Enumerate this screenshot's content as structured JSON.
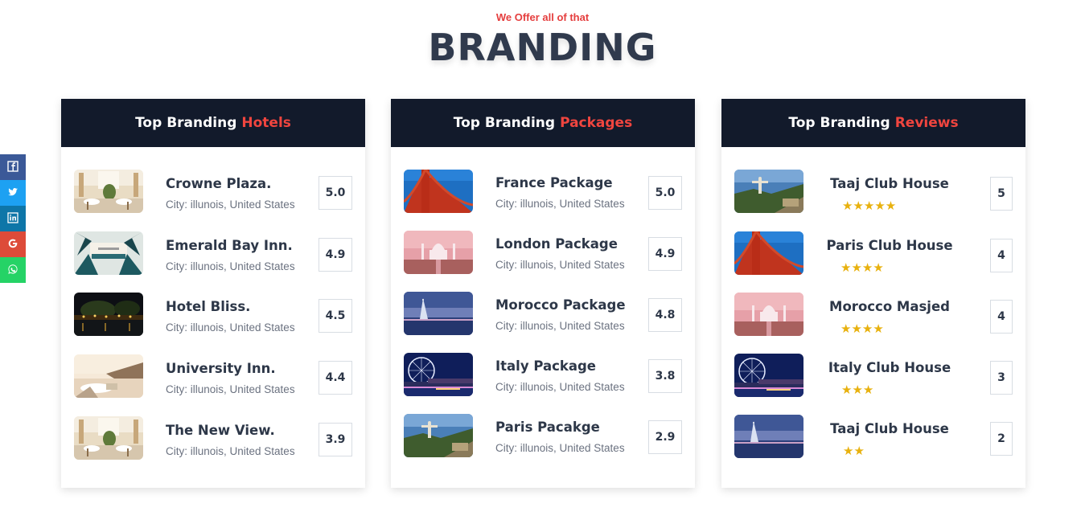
{
  "header": {
    "eyebrow": "We Offer all of that",
    "title": "BRANDING"
  },
  "social": [
    {
      "icon": "facebook-icon",
      "color": "#3b5998",
      "glyph": "f"
    },
    {
      "icon": "twitter-icon",
      "color": "#1da1f2",
      "glyph": "t"
    },
    {
      "icon": "linkedin-icon",
      "color": "#0e76a8",
      "glyph": "in"
    },
    {
      "icon": "google-icon",
      "color": "#dd4b39",
      "glyph": "G"
    },
    {
      "icon": "whatsapp-icon",
      "color": "#25d366",
      "glyph": "w"
    }
  ],
  "hotels": {
    "title": "Top Branding",
    "accent": "Hotels",
    "items": [
      {
        "name": "Crowne Plaza.",
        "city": "City: illunois, United States",
        "rating": "5.0",
        "image": "restaurant-interior"
      },
      {
        "name": "Emerald Bay Inn.",
        "city": "City: illunois, United States",
        "rating": "4.9",
        "image": "palm-resort"
      },
      {
        "name": "Hotel Bliss.",
        "city": "City: illunois, United States",
        "rating": "4.5",
        "image": "night-lake"
      },
      {
        "name": "University Inn.",
        "city": "City: illunois, United States",
        "rating": "4.4",
        "image": "coastal-terrace"
      },
      {
        "name": "The New View.",
        "city": "City: illunois, United States",
        "rating": "3.9",
        "image": "restaurant-interior"
      }
    ]
  },
  "packages": {
    "title": "Top Branding",
    "accent": "Packages",
    "items": [
      {
        "name": "France Package",
        "city": "City: illunois, United States",
        "rating": "5.0",
        "image": "golden-gate-bridge"
      },
      {
        "name": "London Package",
        "city": "City: illunois, United States",
        "rating": "4.9",
        "image": "taj-mahal"
      },
      {
        "name": "Morocco Package",
        "city": "City: illunois, United States",
        "rating": "4.8",
        "image": "burj-al-arab"
      },
      {
        "name": "Italy Package",
        "city": "City: illunois, United States",
        "rating": "3.8",
        "image": "ferris-wheel"
      },
      {
        "name": "Paris Pacakge",
        "city": "City: illunois, United States",
        "rating": "2.9",
        "image": "christ-redeemer"
      }
    ]
  },
  "reviews": {
    "title": "Top Branding",
    "accent": "Reviews",
    "items": [
      {
        "name": "Taaj Club House",
        "stars": 5,
        "stars_text": "★★★★★",
        "rating": "5",
        "image": "christ-redeemer"
      },
      {
        "name": "Paris Club House",
        "stars": 4,
        "stars_text": "★★★★",
        "rating": "4",
        "image": "golden-gate-bridge"
      },
      {
        "name": "Morocco Masjed",
        "stars": 4,
        "stars_text": "★★★★",
        "rating": "4",
        "image": "taj-mahal"
      },
      {
        "name": "Italy Club House",
        "stars": 3,
        "stars_text": "★★★",
        "rating": "3",
        "image": "ferris-wheel"
      },
      {
        "name": "Taaj Club House",
        "stars": 2,
        "stars_text": "★★",
        "rating": "2",
        "image": "burj-al-arab"
      }
    ]
  },
  "colors": {
    "dark": "#121a2b",
    "accent": "#f0453f",
    "star": "#e8b10e",
    "eyebrow": "#e53e3e"
  }
}
